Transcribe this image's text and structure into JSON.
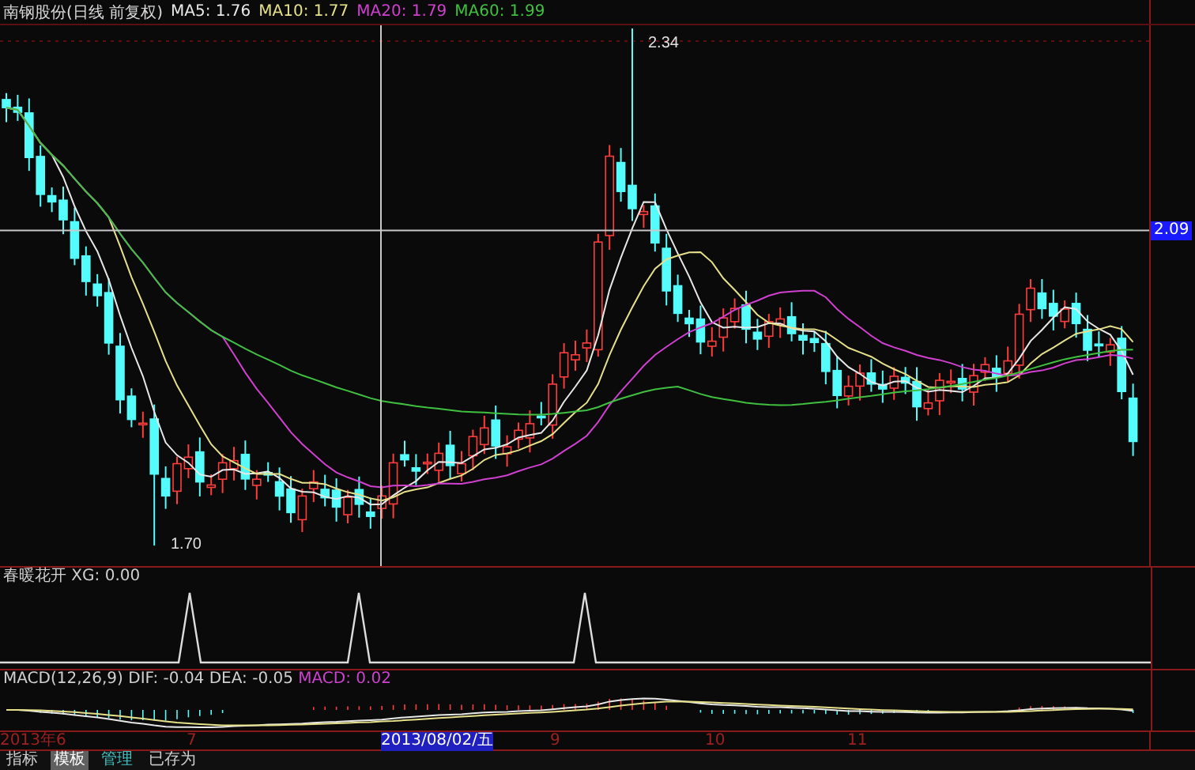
{
  "main_chart": {
    "title": "南钢股份(日线 前复权)",
    "indicators": [
      {
        "label": "MA5: 1.76",
        "color": "#e8e8e8"
      },
      {
        "label": "MA10: 1.77",
        "color": "#e6e08a"
      },
      {
        "label": "MA20: 1.79",
        "color": "#d040d0"
      },
      {
        "label": "MA60: 1.99",
        "color": "#40c040"
      }
    ],
    "high_label": "2.34",
    "low_label": "1.70",
    "price_tag": "2.09"
  },
  "signal_panel": {
    "title": "春暖花开 XG: 0.00"
  },
  "macd_panel": {
    "title": "MACD(12,26,9) DIF: -0.04 DEA: -0.05",
    "macd_value": "MACD: 0.02"
  },
  "date_axis": [
    {
      "label": "2013年6",
      "selected": false
    },
    {
      "label": "7",
      "selected": false
    },
    {
      "label": "2013/08/02/五",
      "selected": true
    },
    {
      "label": "9",
      "selected": false
    },
    {
      "label": "10",
      "selected": false
    },
    {
      "label": "11",
      "selected": false
    }
  ],
  "toolbar": [
    {
      "label": "指标",
      "selected": false,
      "kind": "text"
    },
    {
      "label": "模板",
      "selected": true,
      "kind": "text"
    },
    {
      "label": "管理",
      "selected": false,
      "kind": "link"
    },
    {
      "label": "已存为",
      "selected": false,
      "kind": "text"
    }
  ]
}
